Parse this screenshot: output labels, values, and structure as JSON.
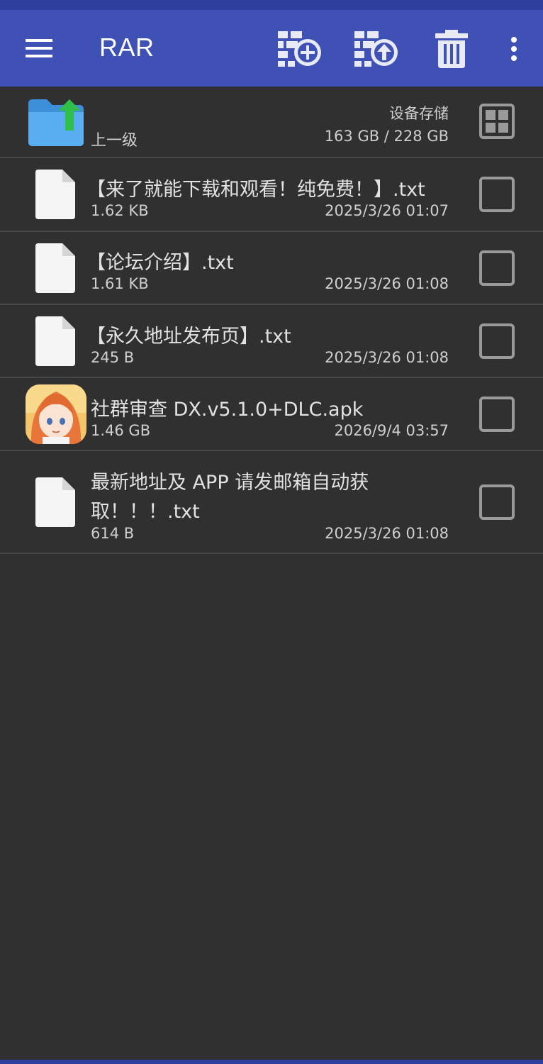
{
  "app_bar": {
    "title": "RAR",
    "icons": [
      "menu-icon",
      "add-to-archive-icon",
      "extract-archive-icon",
      "delete-icon",
      "more-vert-icon"
    ]
  },
  "parent_row": {
    "label": "上一级",
    "storage_label": "设备存储",
    "storage_usage": "163 GB / 228 GB"
  },
  "files": [
    {
      "name": "【来了就能下载和观看！纯免费！】.txt",
      "size": "1.62 KB",
      "date": "2025/3/26 01:07",
      "icon": "document-icon"
    },
    {
      "name": "【论坛介绍】.txt",
      "size": "1.61 KB",
      "date": "2025/3/26 01:08",
      "icon": "document-icon"
    },
    {
      "name": "【永久地址发布页】.txt",
      "size": "245 B",
      "date": "2025/3/26 01:08",
      "icon": "document-icon"
    },
    {
      "name": "社群审查 DX.v5.1.0+DLC.apk",
      "size": "1.46 GB",
      "date": "2026/9/4 03:57",
      "icon": "app-avatar-icon"
    },
    {
      "name_line1": "最新地址及 APP 请发邮箱自动获",
      "name_line2": "取！！！.txt",
      "size": "614 B",
      "date": "2025/3/26 01:08",
      "icon": "document-icon"
    }
  ],
  "colors": {
    "app_bar": "#3f51b5",
    "background": "#303030",
    "folder": "#4a9fe6",
    "up_arrow": "#2fbf4a"
  }
}
